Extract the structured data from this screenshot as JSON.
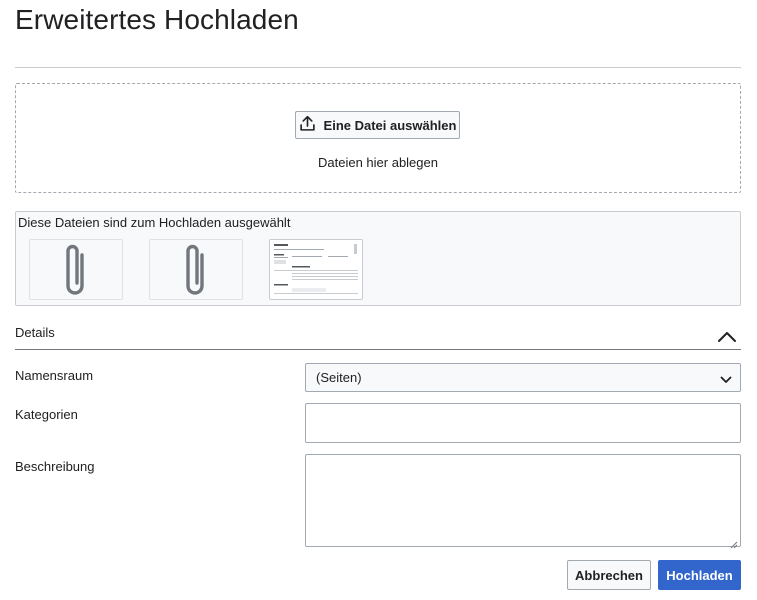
{
  "page": {
    "title": "Erweitertes Hochladen"
  },
  "dropzone": {
    "select_button_label": "Eine Datei auswählen",
    "upload_icon": "upload-icon",
    "hint": "Dateien hier ablegen"
  },
  "selected_files": {
    "label": "Diese Dateien sind zum Hochladen ausgewählt",
    "items": [
      {
        "type": "attachment",
        "icon": "paperclip-icon"
      },
      {
        "type": "attachment",
        "icon": "paperclip-icon"
      },
      {
        "type": "document-preview",
        "icon": "document-thumbnail"
      }
    ]
  },
  "details": {
    "heading": "Details",
    "toggle_icon": "chevron-up-icon",
    "namespace": {
      "label": "Namensraum",
      "value": "(Seiten)",
      "icon": "chevron-down-icon"
    },
    "categories": {
      "label": "Kategorien",
      "value": ""
    },
    "description": {
      "label": "Beschreibung",
      "value": ""
    }
  },
  "actions": {
    "cancel_label": "Abbrechen",
    "upload_label": "Hochladen"
  },
  "colors": {
    "primary": "#3366cc",
    "text": "#202122",
    "border": "#a2a9b1",
    "panel_bg": "#f8f9fa"
  }
}
